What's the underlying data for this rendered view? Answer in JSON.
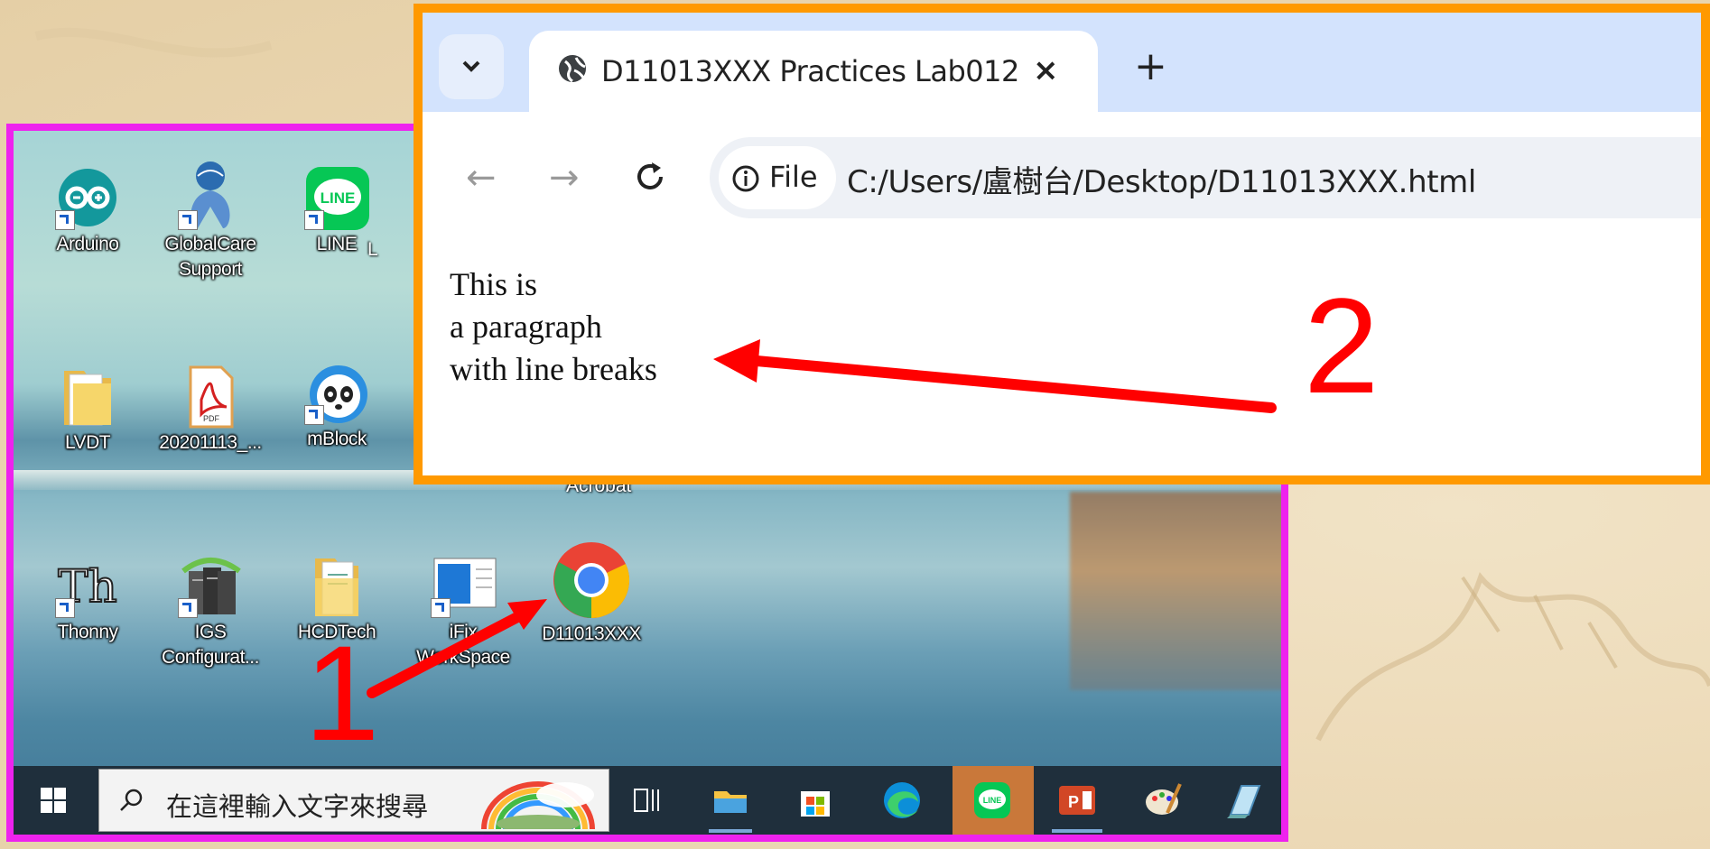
{
  "browser": {
    "tab_title": "D11013XXX Practices Lab012",
    "close_label": "×",
    "new_tab_label": "+",
    "back_label": "←",
    "forward_label": "→",
    "site_info_label": "File",
    "url": "C:/Users/盧樹台/Desktop/D11013XXX.html",
    "content_lines": [
      "This is",
      "a paragraph",
      "with line breaks"
    ]
  },
  "desktop": {
    "icons": [
      {
        "label": "Arduino"
      },
      {
        "label": "GlobalCare Support"
      },
      {
        "label": "LINE"
      },
      {
        "label": "LVDT"
      },
      {
        "label": "20201113_..."
      },
      {
        "label": "mBlock"
      },
      {
        "label": "Thonny"
      },
      {
        "label": "IGS Configurat..."
      },
      {
        "label": "HCDTech"
      },
      {
        "label": "iFix WorkSpace"
      },
      {
        "label": "D11013XXX"
      }
    ],
    "partial_labels": {
      "l_fragment": "L",
      "behind_browser": "Acrobat"
    }
  },
  "taskbar": {
    "search_placeholder": "在這裡輸入文字來搜尋",
    "icons": [
      "windows-start-icon",
      "task-view-icon",
      "file-explorer-icon",
      "microsoft-store-icon",
      "edge-icon",
      "line-app-icon",
      "powerpoint-icon",
      "paint-icon",
      "notepad-icon"
    ]
  },
  "annotations": {
    "step1": "1",
    "step2": "2"
  },
  "colors": {
    "frame_desktop": "#ee22ee",
    "frame_browser": "#ff9900",
    "arrow": "#ff0000"
  }
}
